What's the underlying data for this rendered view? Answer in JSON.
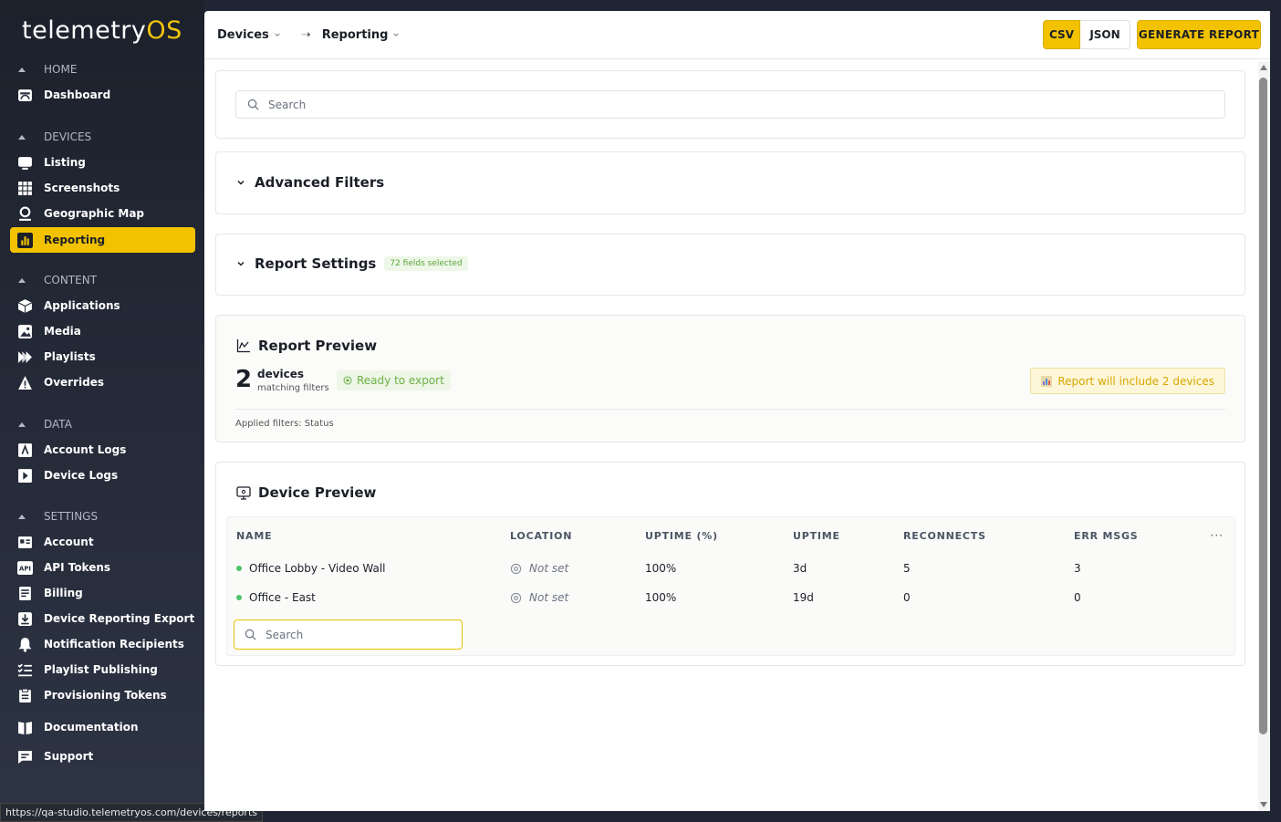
{
  "app": {
    "logo_main": "telemetry",
    "logo_accent": "OS",
    "status_url": "https://qa-studio.telemetryos.com/devices/reports"
  },
  "sidebar": {
    "sections": [
      {
        "title": "HOME",
        "items": [
          {
            "label": "Dashboard",
            "icon": "dashboard-icon"
          }
        ]
      },
      {
        "title": "DEVICES",
        "items": [
          {
            "label": "Listing",
            "icon": "monitor-icon"
          },
          {
            "label": "Screenshots",
            "icon": "grid-icon"
          },
          {
            "label": "Geographic Map",
            "icon": "map-pin-icon"
          },
          {
            "label": "Reporting",
            "icon": "bar-chart-icon",
            "active": true
          }
        ]
      },
      {
        "title": "CONTENT",
        "items": [
          {
            "label": "Applications",
            "icon": "cube-icon"
          },
          {
            "label": "Media",
            "icon": "image-icon"
          },
          {
            "label": "Playlists",
            "icon": "playlist-icon"
          },
          {
            "label": "Overrides",
            "icon": "warning-icon"
          }
        ]
      },
      {
        "title": "DATA",
        "items": [
          {
            "label": "Account Logs",
            "icon": "account-log-icon"
          },
          {
            "label": "Device Logs",
            "icon": "device-log-icon"
          }
        ]
      },
      {
        "title": "SETTINGS",
        "items": [
          {
            "label": "Account",
            "icon": "id-card-icon"
          },
          {
            "label": "API Tokens",
            "icon": "api-icon"
          },
          {
            "label": "Billing",
            "icon": "receipt-icon"
          },
          {
            "label": "Device Reporting Export",
            "icon": "download-icon"
          },
          {
            "label": "Notification Recipients",
            "icon": "bell-icon"
          },
          {
            "label": "Playlist Publishing",
            "icon": "checklist-icon"
          },
          {
            "label": "Provisioning Tokens",
            "icon": "clipboard-icon"
          }
        ]
      }
    ],
    "footer": [
      {
        "label": "Documentation",
        "icon": "book-icon"
      },
      {
        "label": "Support",
        "icon": "chat-icon"
      }
    ]
  },
  "topbar": {
    "crumb1": "Devices",
    "crumb2": "Reporting",
    "csv_label": "CSV",
    "json_label": "JSON",
    "generate_label": "GENERATE REPORT"
  },
  "search": {
    "placeholder": "Search"
  },
  "advanced_filters": {
    "title": "Advanced Filters"
  },
  "report_settings": {
    "title": "Report Settings",
    "badge": "72 fields selected"
  },
  "report_preview": {
    "title": "Report Preview",
    "count": "2",
    "count_label": "devices",
    "count_sub": "matching filters",
    "ready": "Ready to export",
    "include": "Report will include 2 devices",
    "applied": "Applied filters: Status"
  },
  "device_preview": {
    "title": "Device Preview",
    "columns": [
      "NAME",
      "LOCATION",
      "UPTIME (%)",
      "UPTIME",
      "RECONNECTS",
      "ERR MSGS"
    ],
    "more": "···",
    "rows": [
      {
        "name": "Office Lobby - Video Wall",
        "location": "Not set",
        "uptime_pct": "100%",
        "uptime": "3d",
        "reconnects": "5",
        "err": "3"
      },
      {
        "name": "Office - East",
        "location": "Not set",
        "uptime_pct": "100%",
        "uptime": "19d",
        "reconnects": "0",
        "err": "0"
      }
    ],
    "search_placeholder": "Search"
  },
  "colors": {
    "accent": "#f2c200",
    "sidebar_bg": "#1f2532",
    "success": "#4cc46a"
  }
}
